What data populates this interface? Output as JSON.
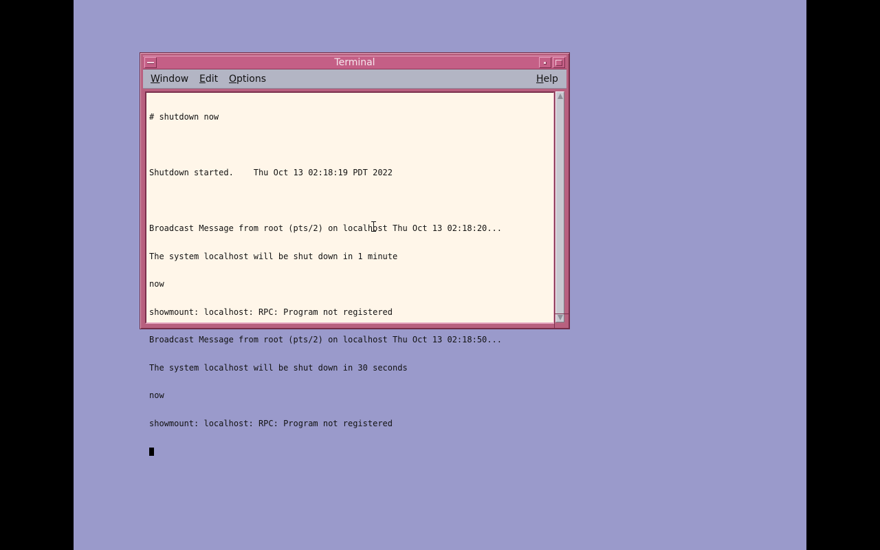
{
  "window": {
    "title": "Terminal"
  },
  "menubar": {
    "window": {
      "mnemonic": "W",
      "rest": "indow"
    },
    "edit": {
      "mnemonic": "E",
      "rest": "dit"
    },
    "options": {
      "mnemonic": "O",
      "rest": "ptions"
    },
    "help": {
      "mnemonic": "H",
      "rest": "elp"
    }
  },
  "terminal": {
    "lines": [
      "# shutdown now",
      "",
      "Shutdown started.    Thu Oct 13 02:18:19 PDT 2022",
      "",
      "Broadcast Message from root (pts/2) on localhost Thu Oct 13 02:18:20...",
      "The system localhost will be shut down in 1 minute",
      "now",
      "showmount: localhost: RPC: Program not registered",
      "Broadcast Message from root (pts/2) on localhost Thu Oct 13 02:18:50...",
      "The system localhost will be shut down in 30 seconds",
      "now",
      "showmount: localhost: RPC: Program not registered"
    ]
  },
  "icons": {
    "window_menu": "window-menu-icon",
    "minimize": "minimize-icon",
    "maximize": "maximize-icon",
    "text_cursor": "text-cursor-icon",
    "mouse_pointer": "ibeam-pointer-icon"
  },
  "colors": {
    "desktop": "#9a9acb",
    "title_bar": "#c45f86",
    "terminal_background": "#fff6e9",
    "menubar": "#b3b5c4"
  }
}
